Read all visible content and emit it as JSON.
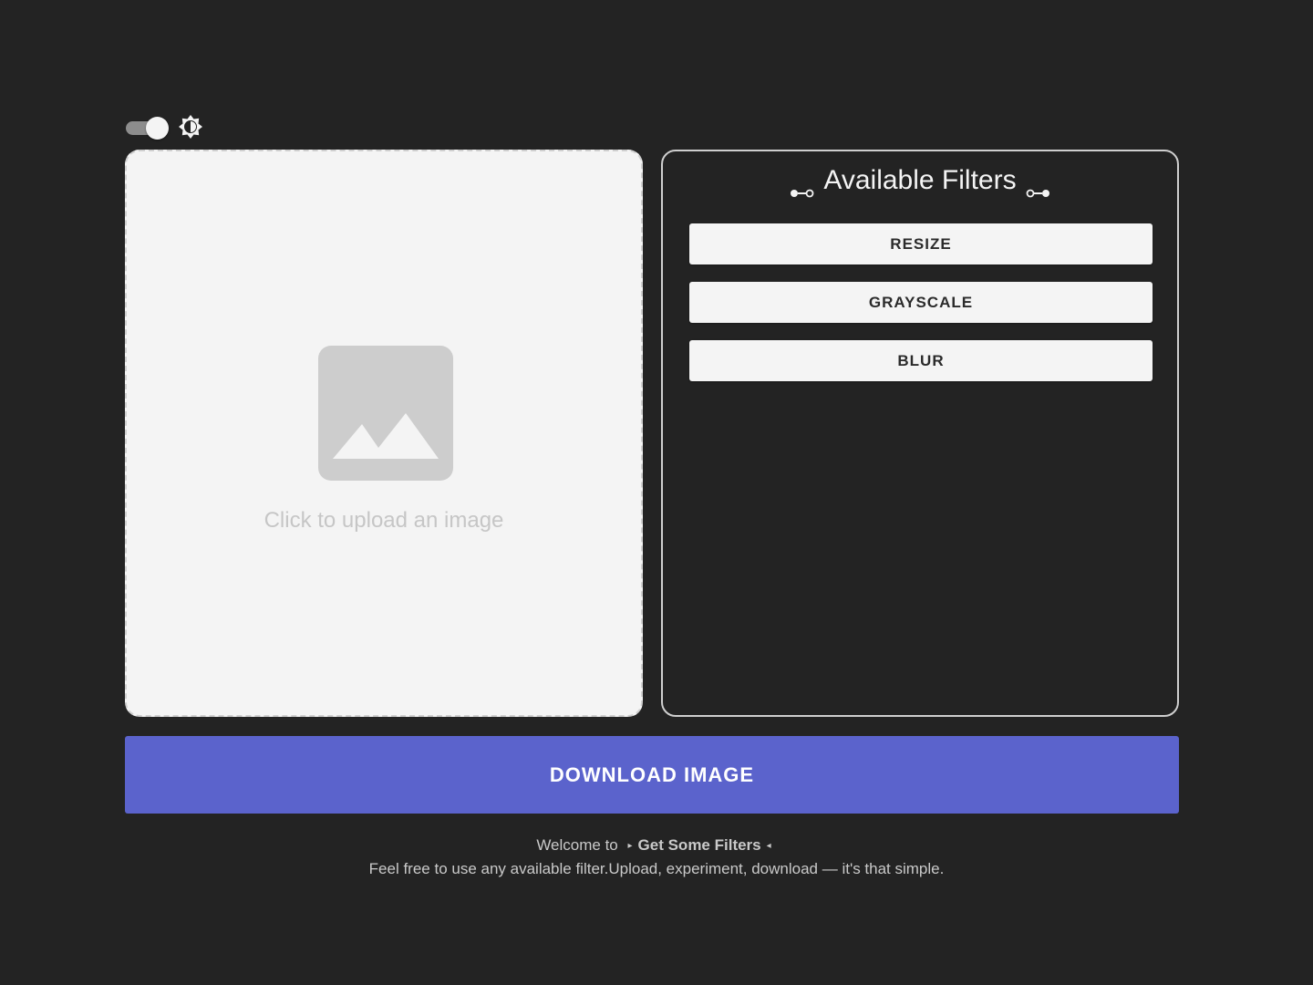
{
  "theme": {
    "toggle_state": "on",
    "icon": "brightness-icon"
  },
  "upload": {
    "icon": "image-placeholder-icon",
    "text": "Click to upload an image"
  },
  "filters": {
    "heading": "Available Filters",
    "heading_left_icon": "connector-left-icon",
    "heading_right_icon": "connector-right-icon",
    "items": [
      {
        "label": "RESIZE"
      },
      {
        "label": "GRAYSCALE"
      },
      {
        "label": "BLUR"
      }
    ]
  },
  "download": {
    "label": "DOWNLOAD IMAGE"
  },
  "footer": {
    "welcome": "Welcome to",
    "arrow_left": "▸",
    "app_name": "Get Some Filters",
    "arrow_right": "◂",
    "tagline": "Feel free to use any available filter.Upload, experiment, download — it's that simple."
  },
  "colors": {
    "background": "#232323",
    "panel": "#f4f4f4",
    "accent": "#5b63cc",
    "border": "#cfcfcf"
  }
}
